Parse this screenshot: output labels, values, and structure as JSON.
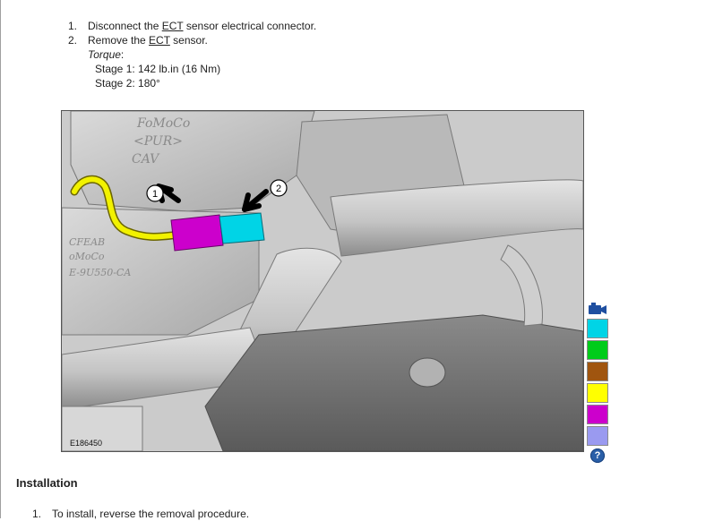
{
  "removal": {
    "steps": [
      {
        "number": "1.",
        "before": "Disconnect the ",
        "term": "ECT",
        "after": " sensor electrical connector."
      },
      {
        "number": "2.",
        "before": "Remove the ",
        "term": "ECT",
        "after": " sensor."
      }
    ],
    "torque": {
      "label": "Torque",
      "label_suffix": ":",
      "stage1": "Stage 1:  142 lb.in (16 Nm)",
      "stage2": "Stage 2:  180°"
    }
  },
  "figure": {
    "id": "E186450",
    "callouts": [
      "1",
      "2"
    ],
    "embossed_text": [
      "FoMoCo",
      "<PUR>",
      "CAV",
      "CFEAB",
      "oMoCo",
      "E-9U550-CA"
    ]
  },
  "legend": {
    "colors": {
      "primary": "#00d4e6",
      "secondary": "#00cc1a",
      "tertiary": "#a0550f",
      "quaternary": "#ffff00",
      "quinary": "#cc00cc",
      "senary": "#9a9af0"
    },
    "icon": "camera-icon",
    "help": "?"
  },
  "installation": {
    "heading": "Installation",
    "steps": [
      {
        "number": "1.",
        "text": "To install, reverse the removal procedure."
      }
    ]
  }
}
